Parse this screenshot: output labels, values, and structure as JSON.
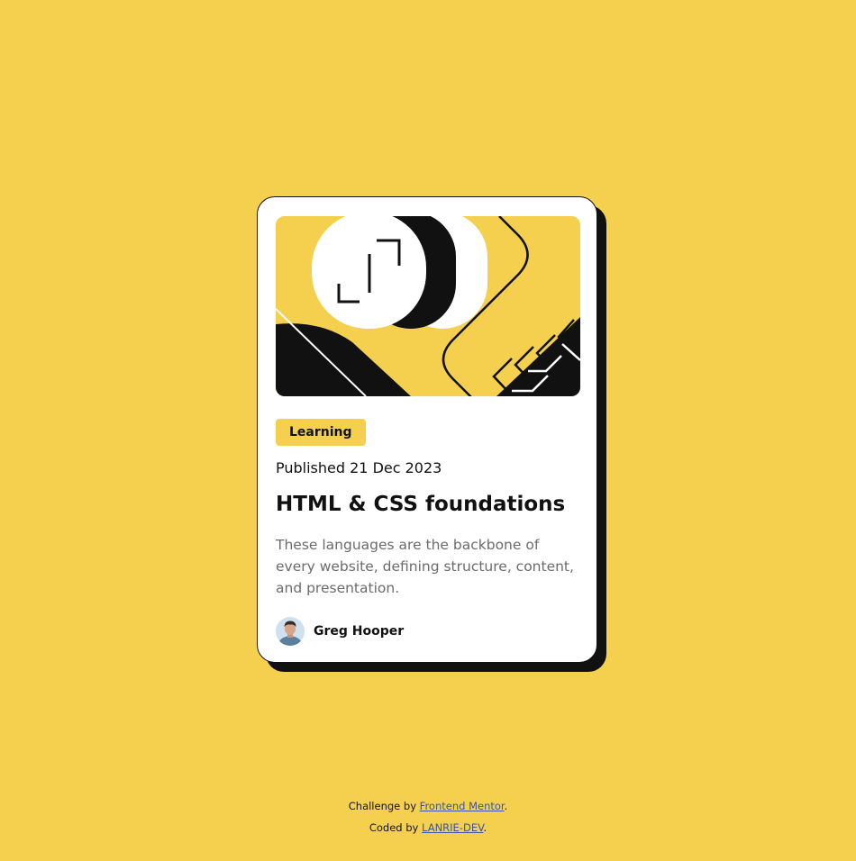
{
  "colors": {
    "background": "#f4d04e",
    "card": "#ffffff",
    "ink": "#111111",
    "muted": "#6b6b6b",
    "link": "#3e52a3"
  },
  "card": {
    "illustration": "abstract-illustration",
    "tag": "Learning",
    "published": "Published 21 Dec 2023",
    "title": "HTML & CSS foundations",
    "description": "These languages are the backbone of every website, defining structure, content, and presentation.",
    "author": {
      "name": "Greg Hooper",
      "avatar_icon": "avatar-photo"
    }
  },
  "footer": {
    "challenge_prefix": "Challenge by ",
    "challenge_link": "Frontend Mentor",
    "challenge_suffix": ".",
    "coded_prefix": "Coded by ",
    "coded_link": "LANRIE-DEV",
    "coded_suffix": "."
  }
}
